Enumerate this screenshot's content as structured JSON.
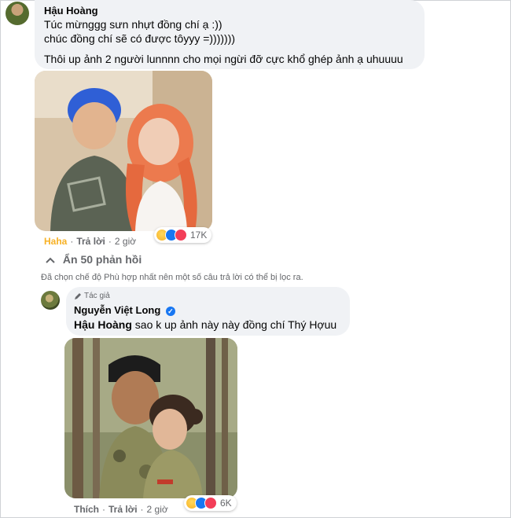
{
  "comment1": {
    "author": "Hậu Hoàng",
    "lines": [
      "Túc mừnggg sưn nhựt đồng chí ạ :))",
      "chúc đồng chí sẽ có được tôyyy =)))))))",
      "Thôi up ảnh 2 người lunnnn cho mọi ngừi đỡ cực khổ ghép ảnh ạ uhuuuu"
    ],
    "reaction_label": "Haha",
    "reply_label": "Trả lời",
    "time": "2 giờ",
    "reaction_count": "17K"
  },
  "hide_replies": "Ẩn 50 phản hồi",
  "notice": "Đã chọn chế độ Phù hợp nhất nên một số câu trả lời có thể bị lọc ra.",
  "comment2": {
    "badge": "Tác giả",
    "author": "Nguyễn Việt Long",
    "mention": "Hậu Hoàng",
    "text": " sao k up ảnh này này đồng chí Thý Hợuu",
    "reaction_label": "Thích",
    "reply_label": "Trả lời",
    "time": "2 giờ",
    "reaction_count": "6K"
  },
  "icons": {
    "verified": "verified-badge-icon",
    "pencil": "pencil-icon",
    "chevron": "chevron-up-icon"
  },
  "colors": {
    "bubble": "#f0f2f5",
    "haha": "#f7b125",
    "like": "#1877f2",
    "love": "#f33e58",
    "muted": "#65676b"
  }
}
